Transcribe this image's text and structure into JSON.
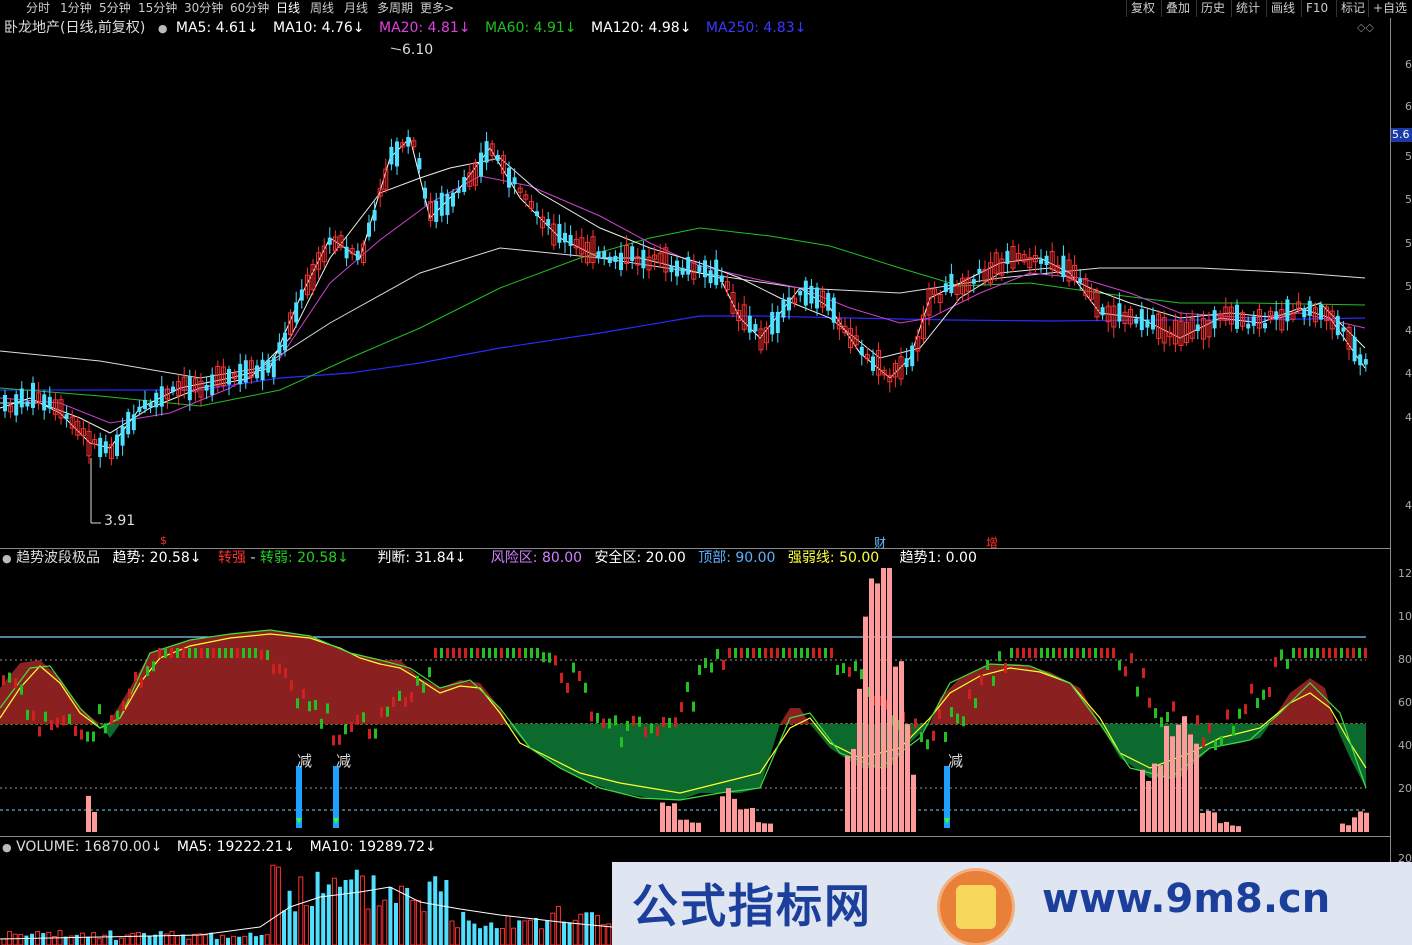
{
  "toolbar": {
    "periods": [
      "分时",
      "1分钟",
      "5分钟",
      "15分钟",
      "30分钟",
      "60分钟",
      "日线",
      "周线",
      "月线",
      "多周期",
      "更多>"
    ],
    "active_period": "日线",
    "right_buttons": [
      "复权",
      "叠加",
      "历史",
      "统计",
      "画线",
      "F10",
      "标记",
      "+自选"
    ]
  },
  "main_legend": {
    "title": "卧龙地产(日线,前复权)",
    "ma5": "MA5: 4.61↓",
    "ma10": "MA10: 4.76↓",
    "ma20": "MA20: 4.81↓",
    "ma60": "MA60: 4.91↓",
    "ma120": "MA120: 4.98↓",
    "ma250": "MA250: 4.83↓",
    "diamonds": "◇◇"
  },
  "main_annotations": {
    "high_label": "6.10",
    "low_label": "3.91",
    "marker_s": "$",
    "marker_cai": "财",
    "marker_zeng": "增"
  },
  "price_axis": {
    "ticks": [
      "6",
      "6",
      "5",
      "5",
      "5",
      "5",
      "4",
      "4",
      "4",
      "4"
    ],
    "current_price_tag": "5.6"
  },
  "indicator_legend": {
    "name": "趋势波段极品",
    "trend": "趋势: 20.58↓",
    "strong": "转强",
    "dash": " - ",
    "weak": "转弱: 20.58↓",
    "judge": "判断: 31.84↓",
    "risk": "风险区: 80.00",
    "safe": "安全区: 20.00",
    "top": "顶部: 90.00",
    "line": "强弱线: 50.00",
    "trend1": "趋势1: 0.00"
  },
  "indicator_axis": {
    "ticks": [
      "12",
      "10",
      "80",
      "60",
      "40",
      "20"
    ]
  },
  "indicator_annotations": {
    "reduce1": "减",
    "reduce2": "减",
    "reduce3": "减"
  },
  "volume_legend": {
    "volume": "VOLUME: 16870.00↓",
    "ma5": "MA5: 19222.21↓",
    "ma10": "MA10: 19289.72↓"
  },
  "volume_axis": {
    "ticks": [
      "20"
    ]
  },
  "watermark": {
    "left_text": "公式指标网",
    "right_text": "www.9m8.cn"
  },
  "colors": {
    "ma5": "#ffffff",
    "ma10": "#ffffff",
    "ma20": "#e040e0",
    "ma60": "#20c020",
    "ma120": "#ffffff",
    "ma250": "#2020ff",
    "up": "#ff3030",
    "down": "#50e0ff",
    "risk_fill": "#8b2020",
    "safe_fill": "#0c6a2e",
    "pink_bar": "#ff9a9a"
  }
}
